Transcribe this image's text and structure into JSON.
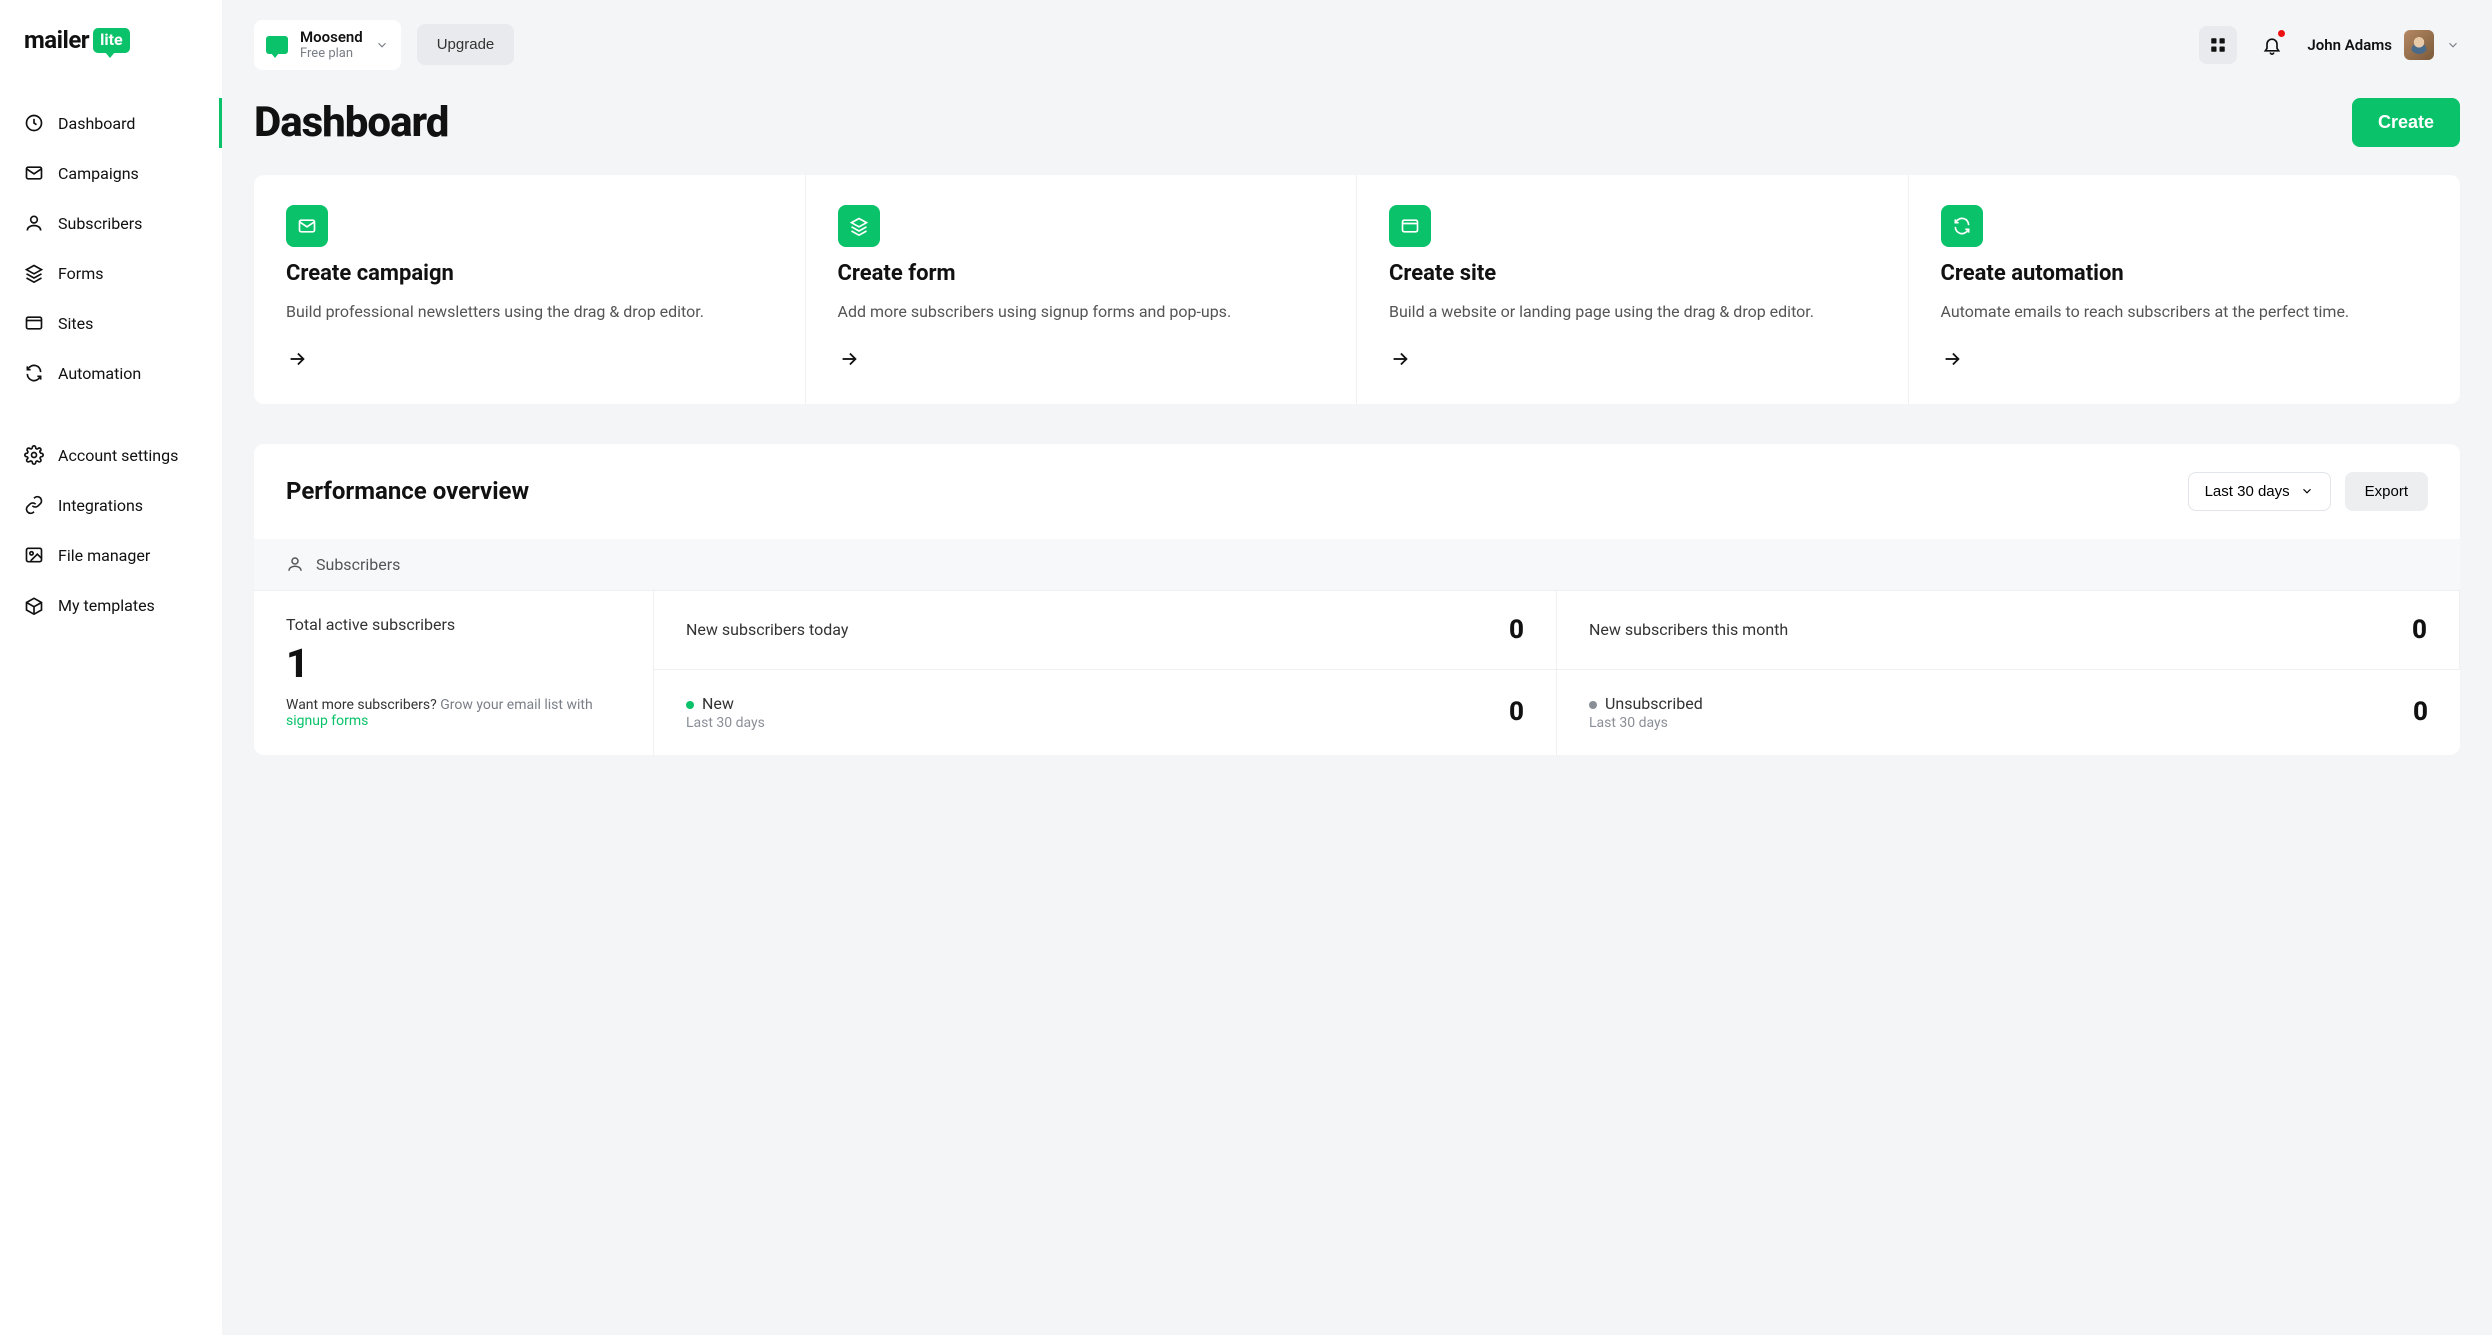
{
  "brand": {
    "name": "mailer",
    "badge": "lite"
  },
  "sidebar": {
    "items": [
      {
        "label": "Dashboard",
        "icon": "clock",
        "active": true
      },
      {
        "label": "Campaigns",
        "icon": "mail",
        "active": false
      },
      {
        "label": "Subscribers",
        "icon": "user",
        "active": false
      },
      {
        "label": "Forms",
        "icon": "layers",
        "active": false
      },
      {
        "label": "Sites",
        "icon": "site",
        "active": false
      },
      {
        "label": "Automation",
        "icon": "refresh",
        "active": false
      }
    ],
    "secondary": [
      {
        "label": "Account settings",
        "icon": "gear"
      },
      {
        "label": "Integrations",
        "icon": "link"
      },
      {
        "label": "File manager",
        "icon": "image"
      },
      {
        "label": "My templates",
        "icon": "box"
      }
    ]
  },
  "topbar": {
    "account_name": "Moosend",
    "account_plan": "Free plan",
    "upgrade_label": "Upgrade",
    "user_name": "John Adams"
  },
  "page": {
    "title": "Dashboard",
    "create_label": "Create"
  },
  "create_cards": [
    {
      "title": "Create campaign",
      "desc": "Build professional newsletters using the drag & drop editor.",
      "icon": "mail"
    },
    {
      "title": "Create form",
      "desc": "Add more subscribers using signup forms and pop-ups.",
      "icon": "layers"
    },
    {
      "title": "Create site",
      "desc": "Build a website or landing page using the drag & drop editor.",
      "icon": "site"
    },
    {
      "title": "Create automation",
      "desc": "Automate emails to reach subscribers at the perfect time.",
      "icon": "refresh"
    }
  ],
  "performance": {
    "title": "Performance overview",
    "range_label": "Last 30 days",
    "export_label": "Export",
    "section_label": "Subscribers",
    "total_label": "Total active subscribers",
    "total_value": "1",
    "hint_prefix": "Want more subscribers? ",
    "hint_mid": "Grow your email list with ",
    "hint_link": "signup forms",
    "cells": {
      "today": {
        "label": "New subscribers today",
        "value": "0"
      },
      "month": {
        "label": "New subscribers this month",
        "value": "0"
      },
      "new": {
        "label": "New",
        "sub": "Last 30 days",
        "value": "0"
      },
      "unsubscribed": {
        "label": "Unsubscribed",
        "sub": "Last 30 days",
        "value": "0"
      }
    }
  }
}
